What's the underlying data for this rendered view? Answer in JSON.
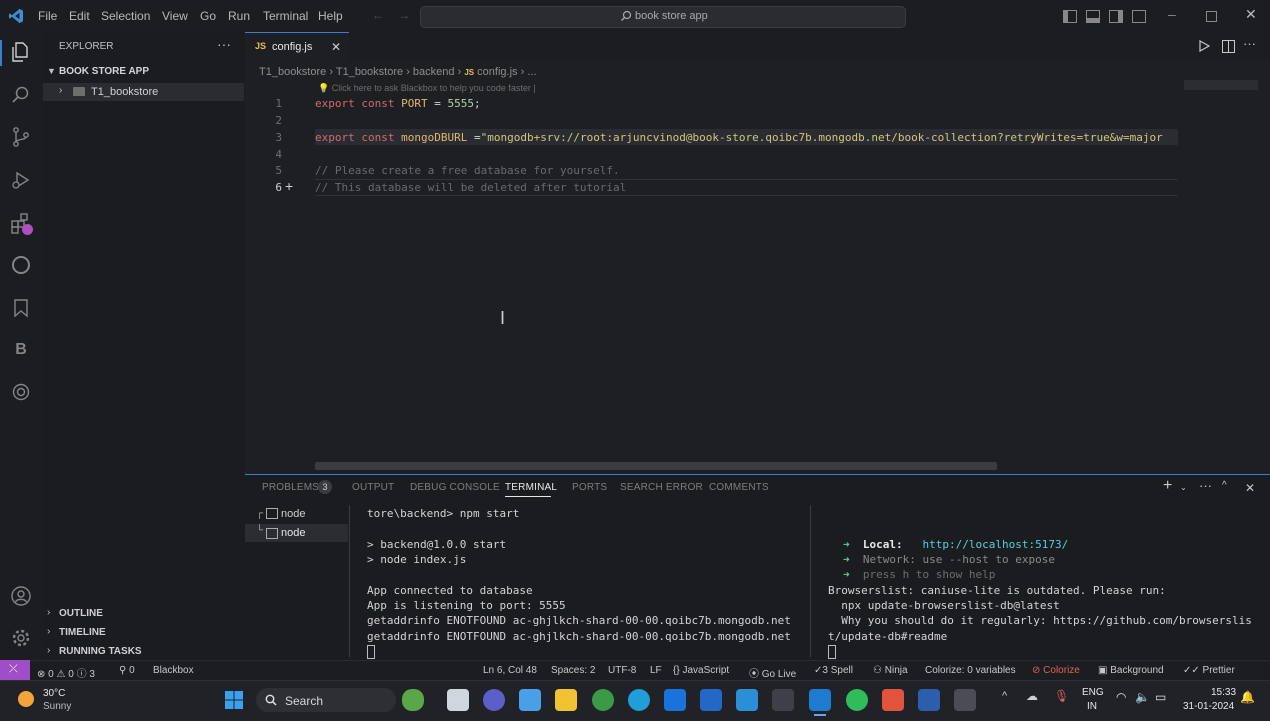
{
  "window": {
    "menu": [
      "File",
      "Edit",
      "Selection",
      "View",
      "Go",
      "Run",
      "Terminal",
      "Help"
    ],
    "search_text": "book store app"
  },
  "sidebar": {
    "explorer_title": "EXPLORER",
    "project": "BOOK STORE APP",
    "folder": "T1_bookstore",
    "sections": [
      "OUTLINE",
      "TIMELINE",
      "RUNNING TASKS"
    ]
  },
  "editor": {
    "tab_label": "config.js",
    "breadcrumb": [
      "T1_bookstore",
      "T1_bookstore",
      "backend",
      "config.js",
      "..."
    ],
    "hint": "Click here to ask Blackbox to help you code faster |",
    "line_numbers": [
      "1",
      "2",
      "3",
      "4",
      "5",
      "6"
    ],
    "line1": {
      "kw1": "export",
      "kw2": "const",
      "name": "PORT",
      "rest": " = ",
      "value": "5555",
      "end": ";"
    },
    "line3": {
      "kw1": "export",
      "kw2": "const",
      "name": "mongoDBURL",
      "rest": " =",
      "value": "\"mongodb+srv://root:arjuncvinod@book-store.qoibc7b.mongodb.net/book-collection?retryWrites=true&w=major"
    },
    "line5": "// Please create a free database for yourself.",
    "line6": "// This database will be deleted after tutorial"
  },
  "panel": {
    "tabs": [
      "PROBLEMS",
      "OUTPUT",
      "DEBUG CONSOLE",
      "TERMINAL",
      "PORTS",
      "SEARCH ERROR",
      "COMMENTS"
    ],
    "problems_count": "3",
    "terminals": [
      "node",
      "node"
    ],
    "left_terminal": [
      "tore\\backend> npm start",
      "",
      "> backend@1.0.0 start",
      "> node index.js",
      "",
      "App connected to database",
      "App is listening to port: 5555",
      "getaddrinfo ENOTFOUND ac-ghjlkch-shard-00-00.qoibc7b.mongodb.net",
      "getaddrinfo ENOTFOUND ac-ghjlkch-shard-00-00.qoibc7b.mongodb.net"
    ],
    "right_terminal": {
      "local_label": "Local:",
      "local_url": "http://localhost:5173/",
      "network_label": "Network:",
      "network_text": "use --host to expose",
      "press_text": "press h to show help",
      "lines": [
        "Browserslist: caniuse-lite is outdated. Please run:",
        "  npx update-browserslist-db@latest",
        "  Why you should do it regularly: https://github.com/browserslis",
        "t/update-db#readme"
      ]
    }
  },
  "statusbar": {
    "errors": "0",
    "warnings": "0",
    "info": "3",
    "ports": "0",
    "blackbox": "Blackbox",
    "position": "Ln 6, Col 48",
    "spaces": "Spaces: 2",
    "encoding": "UTF-8",
    "eol": "LF",
    "language": "JavaScript",
    "golive": "Go Live",
    "spell": "3 Spell",
    "ninja": "Ninja",
    "colorize_vars": "Colorize: 0 variables",
    "colorize": "Colorize",
    "background": "Background",
    "prettier": "Prettier"
  },
  "taskbar": {
    "weather_temp": "30°C",
    "weather_desc": "Sunny",
    "search_label": "Search",
    "lang_top": "ENG",
    "lang_bottom": "IN",
    "time": "15:33",
    "date": "31-01-2024"
  },
  "colors": {
    "accent": "#3c7bd6",
    "statusbar_remote": "#a04dc8"
  }
}
